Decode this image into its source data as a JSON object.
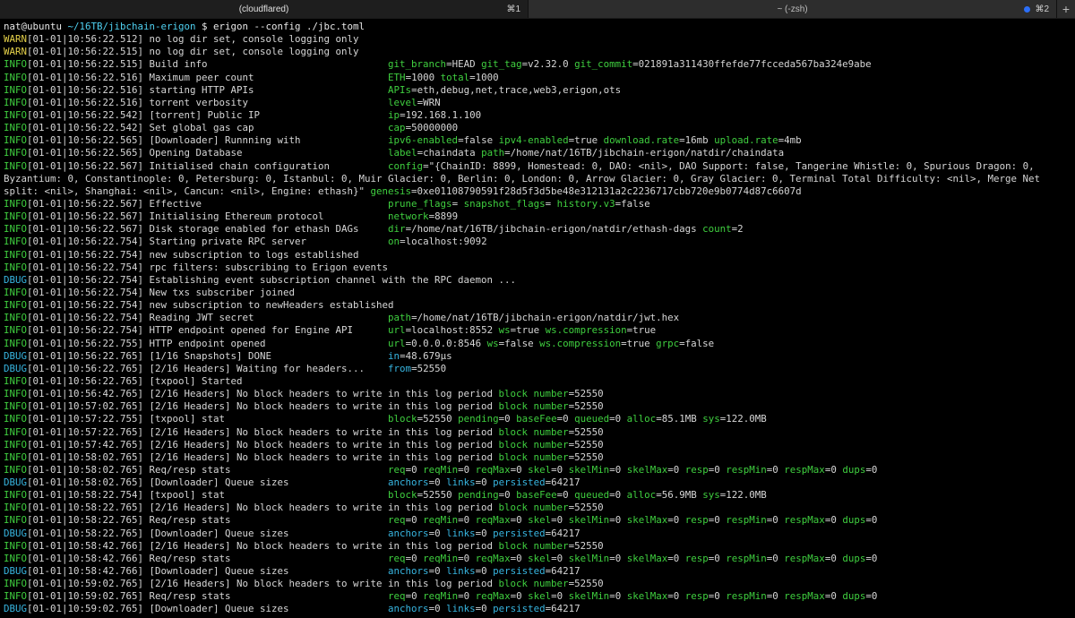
{
  "tabs": [
    {
      "title": "(cloudflared)",
      "shortcut": "⌘1",
      "active": true
    },
    {
      "title": "~ (-zsh)",
      "shortcut": "⌘2",
      "active": false
    }
  ],
  "new_tab": "+",
  "colors": {
    "info": "#3fcf3f",
    "warn": "#e5d14a",
    "dbug": "#37b5e0",
    "key": "#3fcf3f",
    "path": "#4fd0f0"
  },
  "lines": [
    [
      {
        "t": "nat@ubuntu ",
        "c": "w"
      },
      {
        "t": "~/16TB/jibchain-erigon",
        "c": "cy"
      },
      {
        "t": " $ erigon --config ./jbc.toml",
        "c": "w"
      }
    ],
    [
      {
        "t": "WARN",
        "c": "y"
      },
      {
        "t": "[01-01|10:56:22.512] no log dir set, console logging only"
      }
    ],
    [
      {
        "t": "WARN",
        "c": "y"
      },
      {
        "t": "[01-01|10:56:22.515] no log dir set, console logging only"
      }
    ],
    [
      {
        "t": "INFO",
        "c": "g"
      },
      {
        "t": "[01-01|10:56:22.515] Build info                               "
      },
      {
        "t": "git_branch",
        "c": "g"
      },
      {
        "t": "=HEAD "
      },
      {
        "t": "git_tag",
        "c": "g"
      },
      {
        "t": "=v2.32.0 "
      },
      {
        "t": "git_commit",
        "c": "g"
      },
      {
        "t": "=021891a311430ffefde77fcceda567ba324e9abe"
      }
    ],
    [
      {
        "t": "INFO",
        "c": "g"
      },
      {
        "t": "[01-01|10:56:22.516] Maximum peer count                       "
      },
      {
        "t": "ETH",
        "c": "g"
      },
      {
        "t": "=1000 "
      },
      {
        "t": "total",
        "c": "g"
      },
      {
        "t": "=1000"
      }
    ],
    [
      {
        "t": "INFO",
        "c": "g"
      },
      {
        "t": "[01-01|10:56:22.516] starting HTTP APIs                       "
      },
      {
        "t": "APIs",
        "c": "g"
      },
      {
        "t": "=eth,debug,net,trace,web3,erigon,ots"
      }
    ],
    [
      {
        "t": "INFO",
        "c": "g"
      },
      {
        "t": "[01-01|10:56:22.516] torrent verbosity                        "
      },
      {
        "t": "level",
        "c": "g"
      },
      {
        "t": "=WRN"
      }
    ],
    [
      {
        "t": "INFO",
        "c": "g"
      },
      {
        "t": "[01-01|10:56:22.542] [torrent] Public IP                      "
      },
      {
        "t": "ip",
        "c": "g"
      },
      {
        "t": "=192.168.1.100"
      }
    ],
    [
      {
        "t": "INFO",
        "c": "g"
      },
      {
        "t": "[01-01|10:56:22.542] Set global gas cap                       "
      },
      {
        "t": "cap",
        "c": "g"
      },
      {
        "t": "=50000000"
      }
    ],
    [
      {
        "t": "INFO",
        "c": "g"
      },
      {
        "t": "[01-01|10:56:22.565] [Downloader] Runnning with               "
      },
      {
        "t": "ipv6-enabled",
        "c": "g"
      },
      {
        "t": "=false "
      },
      {
        "t": "ipv4-enabled",
        "c": "g"
      },
      {
        "t": "=true "
      },
      {
        "t": "download.rate",
        "c": "g"
      },
      {
        "t": "=16mb "
      },
      {
        "t": "upload.rate",
        "c": "g"
      },
      {
        "t": "=4mb"
      }
    ],
    [
      {
        "t": "INFO",
        "c": "g"
      },
      {
        "t": "[01-01|10:56:22.565] Opening Database                         "
      },
      {
        "t": "label",
        "c": "g"
      },
      {
        "t": "=chaindata "
      },
      {
        "t": "path",
        "c": "g"
      },
      {
        "t": "=/home/nat/16TB/jibchain-erigon/natdir/chaindata"
      }
    ],
    [
      {
        "t": "INFO",
        "c": "g"
      },
      {
        "t": "[01-01|10:56:22.567] Initialised chain configuration          "
      },
      {
        "t": "config",
        "c": "g"
      },
      {
        "t": "=\"{ChainID: 8899, Homestead: 0, DAO: <nil>, DAO Support: false, Tangerine Whistle: 0, Spurious Dragon: 0,"
      }
    ],
    [
      {
        "t": "Byzantium: 0, Constantinople: 0, Petersburg: 0, Istanbul: 0, Muir Glacier: 0, Berlin: 0, London: 0, Arrow Glacier: 0, Gray Glacier: 0, Terminal Total Difficulty: <nil>, Merge Net"
      }
    ],
    [
      {
        "t": "split: <nil>, Shanghai: <nil>, Cancun: <nil>, Engine: ethash}\" "
      },
      {
        "t": "genesis",
        "c": "g"
      },
      {
        "t": "=0xe01108790591f28d5f3d5be48e312131a2c2236717cbb720e9b0774d87c6607d"
      }
    ],
    [
      {
        "t": "INFO",
        "c": "g"
      },
      {
        "t": "[01-01|10:56:22.567] Effective                                "
      },
      {
        "t": "prune_flags",
        "c": "g"
      },
      {
        "t": "= "
      },
      {
        "t": "snapshot_flags",
        "c": "g"
      },
      {
        "t": "= "
      },
      {
        "t": "history.v3",
        "c": "g"
      },
      {
        "t": "=false"
      }
    ],
    [
      {
        "t": "INFO",
        "c": "g"
      },
      {
        "t": "[01-01|10:56:22.567] Initialising Ethereum protocol           "
      },
      {
        "t": "network",
        "c": "g"
      },
      {
        "t": "=8899"
      }
    ],
    [
      {
        "t": "INFO",
        "c": "g"
      },
      {
        "t": "[01-01|10:56:22.567] Disk storage enabled for ethash DAGs     "
      },
      {
        "t": "dir",
        "c": "g"
      },
      {
        "t": "=/home/nat/16TB/jibchain-erigon/natdir/ethash-dags "
      },
      {
        "t": "count",
        "c": "g"
      },
      {
        "t": "=2"
      }
    ],
    [
      {
        "t": "INFO",
        "c": "g"
      },
      {
        "t": "[01-01|10:56:22.754] Starting private RPC server              "
      },
      {
        "t": "on",
        "c": "g"
      },
      {
        "t": "=localhost:9092"
      }
    ],
    [
      {
        "t": "INFO",
        "c": "g"
      },
      {
        "t": "[01-01|10:56:22.754] new subscription to logs established"
      }
    ],
    [
      {
        "t": "INFO",
        "c": "g"
      },
      {
        "t": "[01-01|10:56:22.754] rpc filters: subscribing to Erigon events"
      }
    ],
    [
      {
        "t": "DBUG",
        "c": "c"
      },
      {
        "t": "[01-01|10:56:22.754] Establishing event subscription channel with the RPC daemon ..."
      }
    ],
    [
      {
        "t": "INFO",
        "c": "g"
      },
      {
        "t": "[01-01|10:56:22.754] New txs subscriber joined"
      }
    ],
    [
      {
        "t": "INFO",
        "c": "g"
      },
      {
        "t": "[01-01|10:56:22.754] new subscription to newHeaders established"
      }
    ],
    [
      {
        "t": "INFO",
        "c": "g"
      },
      {
        "t": "[01-01|10:56:22.754] Reading JWT secret                       "
      },
      {
        "t": "path",
        "c": "g"
      },
      {
        "t": "=/home/nat/16TB/jibchain-erigon/natdir/jwt.hex"
      }
    ],
    [
      {
        "t": "INFO",
        "c": "g"
      },
      {
        "t": "[01-01|10:56:22.754] HTTP endpoint opened for Engine API      "
      },
      {
        "t": "url",
        "c": "g"
      },
      {
        "t": "=localhost:8552 "
      },
      {
        "t": "ws",
        "c": "g"
      },
      {
        "t": "=true "
      },
      {
        "t": "ws.compression",
        "c": "g"
      },
      {
        "t": "=true"
      }
    ],
    [
      {
        "t": "INFO",
        "c": "g"
      },
      {
        "t": "[01-01|10:56:22.755] HTTP endpoint opened                     "
      },
      {
        "t": "url",
        "c": "g"
      },
      {
        "t": "=0.0.0.0:8546 "
      },
      {
        "t": "ws",
        "c": "g"
      },
      {
        "t": "=false "
      },
      {
        "t": "ws.compression",
        "c": "g"
      },
      {
        "t": "=true "
      },
      {
        "t": "grpc",
        "c": "g"
      },
      {
        "t": "=false"
      }
    ],
    [
      {
        "t": "DBUG",
        "c": "c"
      },
      {
        "t": "[01-01|10:56:22.765] [1/16 Snapshots] DONE                    "
      },
      {
        "t": "in",
        "c": "c"
      },
      {
        "t": "=48.679µs"
      }
    ],
    [
      {
        "t": "DBUG",
        "c": "c"
      },
      {
        "t": "[01-01|10:56:22.765] [2/16 Headers] Waiting for headers...    "
      },
      {
        "t": "from",
        "c": "c"
      },
      {
        "t": "=52550"
      }
    ],
    [
      {
        "t": "INFO",
        "c": "g"
      },
      {
        "t": "[01-01|10:56:22.765] [txpool] Started"
      }
    ],
    [
      {
        "t": "INFO",
        "c": "g"
      },
      {
        "t": "[01-01|10:56:42.765] [2/16 Headers] No block headers to write in this log period "
      },
      {
        "t": "block number",
        "c": "g"
      },
      {
        "t": "=52550"
      }
    ],
    [
      {
        "t": "INFO",
        "c": "g"
      },
      {
        "t": "[01-01|10:57:02.765] [2/16 Headers] No block headers to write in this log period "
      },
      {
        "t": "block number",
        "c": "g"
      },
      {
        "t": "=52550"
      }
    ],
    [
      {
        "t": "INFO",
        "c": "g"
      },
      {
        "t": "[01-01|10:57:22.755] [txpool] stat                            "
      },
      {
        "t": "block",
        "c": "g"
      },
      {
        "t": "=52550 "
      },
      {
        "t": "pending",
        "c": "g"
      },
      {
        "t": "=0 "
      },
      {
        "t": "baseFee",
        "c": "g"
      },
      {
        "t": "=0 "
      },
      {
        "t": "queued",
        "c": "g"
      },
      {
        "t": "=0 "
      },
      {
        "t": "alloc",
        "c": "g"
      },
      {
        "t": "=85.1MB "
      },
      {
        "t": "sys",
        "c": "g"
      },
      {
        "t": "=122.0MB"
      }
    ],
    [
      {
        "t": "INFO",
        "c": "g"
      },
      {
        "t": "[01-01|10:57:22.765] [2/16 Headers] No block headers to write in this log period "
      },
      {
        "t": "block number",
        "c": "g"
      },
      {
        "t": "=52550"
      }
    ],
    [
      {
        "t": "INFO",
        "c": "g"
      },
      {
        "t": "[01-01|10:57:42.765] [2/16 Headers] No block headers to write in this log period "
      },
      {
        "t": "block number",
        "c": "g"
      },
      {
        "t": "=52550"
      }
    ],
    [
      {
        "t": "INFO",
        "c": "g"
      },
      {
        "t": "[01-01|10:58:02.765] [2/16 Headers] No block headers to write in this log period "
      },
      {
        "t": "block number",
        "c": "g"
      },
      {
        "t": "=52550"
      }
    ],
    [
      {
        "t": "INFO",
        "c": "g"
      },
      {
        "t": "[01-01|10:58:02.765] Req/resp stats                           "
      },
      {
        "t": "req",
        "c": "g"
      },
      {
        "t": "=0 "
      },
      {
        "t": "reqMin",
        "c": "g"
      },
      {
        "t": "=0 "
      },
      {
        "t": "reqMax",
        "c": "g"
      },
      {
        "t": "=0 "
      },
      {
        "t": "skel",
        "c": "g"
      },
      {
        "t": "=0 "
      },
      {
        "t": "skelMin",
        "c": "g"
      },
      {
        "t": "=0 "
      },
      {
        "t": "skelMax",
        "c": "g"
      },
      {
        "t": "=0 "
      },
      {
        "t": "resp",
        "c": "g"
      },
      {
        "t": "=0 "
      },
      {
        "t": "respMin",
        "c": "g"
      },
      {
        "t": "=0 "
      },
      {
        "t": "respMax",
        "c": "g"
      },
      {
        "t": "=0 "
      },
      {
        "t": "dups",
        "c": "g"
      },
      {
        "t": "=0"
      }
    ],
    [
      {
        "t": "DBUG",
        "c": "c"
      },
      {
        "t": "[01-01|10:58:02.765] [Downloader] Queue sizes                 "
      },
      {
        "t": "anchors",
        "c": "c"
      },
      {
        "t": "=0 "
      },
      {
        "t": "links",
        "c": "c"
      },
      {
        "t": "=0 "
      },
      {
        "t": "persisted",
        "c": "c"
      },
      {
        "t": "=64217"
      }
    ],
    [
      {
        "t": "INFO",
        "c": "g"
      },
      {
        "t": "[01-01|10:58:22.754] [txpool] stat                            "
      },
      {
        "t": "block",
        "c": "g"
      },
      {
        "t": "=52550 "
      },
      {
        "t": "pending",
        "c": "g"
      },
      {
        "t": "=0 "
      },
      {
        "t": "baseFee",
        "c": "g"
      },
      {
        "t": "=0 "
      },
      {
        "t": "queued",
        "c": "g"
      },
      {
        "t": "=0 "
      },
      {
        "t": "alloc",
        "c": "g"
      },
      {
        "t": "=56.9MB "
      },
      {
        "t": "sys",
        "c": "g"
      },
      {
        "t": "=122.0MB"
      }
    ],
    [
      {
        "t": "INFO",
        "c": "g"
      },
      {
        "t": "[01-01|10:58:22.765] [2/16 Headers] No block headers to write in this log period "
      },
      {
        "t": "block number",
        "c": "g"
      },
      {
        "t": "=52550"
      }
    ],
    [
      {
        "t": "INFO",
        "c": "g"
      },
      {
        "t": "[01-01|10:58:22.765] Req/resp stats                           "
      },
      {
        "t": "req",
        "c": "g"
      },
      {
        "t": "=0 "
      },
      {
        "t": "reqMin",
        "c": "g"
      },
      {
        "t": "=0 "
      },
      {
        "t": "reqMax",
        "c": "g"
      },
      {
        "t": "=0 "
      },
      {
        "t": "skel",
        "c": "g"
      },
      {
        "t": "=0 "
      },
      {
        "t": "skelMin",
        "c": "g"
      },
      {
        "t": "=0 "
      },
      {
        "t": "skelMax",
        "c": "g"
      },
      {
        "t": "=0 "
      },
      {
        "t": "resp",
        "c": "g"
      },
      {
        "t": "=0 "
      },
      {
        "t": "respMin",
        "c": "g"
      },
      {
        "t": "=0 "
      },
      {
        "t": "respMax",
        "c": "g"
      },
      {
        "t": "=0 "
      },
      {
        "t": "dups",
        "c": "g"
      },
      {
        "t": "=0"
      }
    ],
    [
      {
        "t": "DBUG",
        "c": "c"
      },
      {
        "t": "[01-01|10:58:22.765] [Downloader] Queue sizes                 "
      },
      {
        "t": "anchors",
        "c": "c"
      },
      {
        "t": "=0 "
      },
      {
        "t": "links",
        "c": "c"
      },
      {
        "t": "=0 "
      },
      {
        "t": "persisted",
        "c": "c"
      },
      {
        "t": "=64217"
      }
    ],
    [
      {
        "t": "INFO",
        "c": "g"
      },
      {
        "t": "[01-01|10:58:42.766] [2/16 Headers] No block headers to write in this log period "
      },
      {
        "t": "block number",
        "c": "g"
      },
      {
        "t": "=52550"
      }
    ],
    [
      {
        "t": "INFO",
        "c": "g"
      },
      {
        "t": "[01-01|10:58:42.766] Req/resp stats                           "
      },
      {
        "t": "req",
        "c": "g"
      },
      {
        "t": "=0 "
      },
      {
        "t": "reqMin",
        "c": "g"
      },
      {
        "t": "=0 "
      },
      {
        "t": "reqMax",
        "c": "g"
      },
      {
        "t": "=0 "
      },
      {
        "t": "skel",
        "c": "g"
      },
      {
        "t": "=0 "
      },
      {
        "t": "skelMin",
        "c": "g"
      },
      {
        "t": "=0 "
      },
      {
        "t": "skelMax",
        "c": "g"
      },
      {
        "t": "=0 "
      },
      {
        "t": "resp",
        "c": "g"
      },
      {
        "t": "=0 "
      },
      {
        "t": "respMin",
        "c": "g"
      },
      {
        "t": "=0 "
      },
      {
        "t": "respMax",
        "c": "g"
      },
      {
        "t": "=0 "
      },
      {
        "t": "dups",
        "c": "g"
      },
      {
        "t": "=0"
      }
    ],
    [
      {
        "t": "DBUG",
        "c": "c"
      },
      {
        "t": "[01-01|10:58:42.766] [Downloader] Queue sizes                 "
      },
      {
        "t": "anchors",
        "c": "c"
      },
      {
        "t": "=0 "
      },
      {
        "t": "links",
        "c": "c"
      },
      {
        "t": "=0 "
      },
      {
        "t": "persisted",
        "c": "c"
      },
      {
        "t": "=64217"
      }
    ],
    [
      {
        "t": "INFO",
        "c": "g"
      },
      {
        "t": "[01-01|10:59:02.765] [2/16 Headers] No block headers to write in this log period "
      },
      {
        "t": "block number",
        "c": "g"
      },
      {
        "t": "=52550"
      }
    ],
    [
      {
        "t": "INFO",
        "c": "g"
      },
      {
        "t": "[01-01|10:59:02.765] Req/resp stats                           "
      },
      {
        "t": "req",
        "c": "g"
      },
      {
        "t": "=0 "
      },
      {
        "t": "reqMin",
        "c": "g"
      },
      {
        "t": "=0 "
      },
      {
        "t": "reqMax",
        "c": "g"
      },
      {
        "t": "=0 "
      },
      {
        "t": "skel",
        "c": "g"
      },
      {
        "t": "=0 "
      },
      {
        "t": "skelMin",
        "c": "g"
      },
      {
        "t": "=0 "
      },
      {
        "t": "skelMax",
        "c": "g"
      },
      {
        "t": "=0 "
      },
      {
        "t": "resp",
        "c": "g"
      },
      {
        "t": "=0 "
      },
      {
        "t": "respMin",
        "c": "g"
      },
      {
        "t": "=0 "
      },
      {
        "t": "respMax",
        "c": "g"
      },
      {
        "t": "=0 "
      },
      {
        "t": "dups",
        "c": "g"
      },
      {
        "t": "=0"
      }
    ],
    [
      {
        "t": "DBUG",
        "c": "c"
      },
      {
        "t": "[01-01|10:59:02.765] [Downloader] Queue sizes                 "
      },
      {
        "t": "anchors",
        "c": "c"
      },
      {
        "t": "=0 "
      },
      {
        "t": "links",
        "c": "c"
      },
      {
        "t": "=0 "
      },
      {
        "t": "persisted",
        "c": "c"
      },
      {
        "t": "=64217"
      }
    ]
  ]
}
